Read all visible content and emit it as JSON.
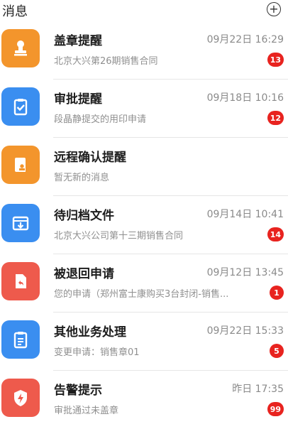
{
  "header": {
    "title": "消息",
    "add_icon": "plus-circle-icon"
  },
  "items": [
    {
      "icon": "stamp-icon",
      "color": "#f3952c",
      "title": "盖章提醒",
      "time": "09月22日 16:29",
      "subtitle": "北京大兴第26期销售合同",
      "badge": "13"
    },
    {
      "icon": "clipboard-check-icon",
      "color": "#3a8ef0",
      "title": "审批提醒",
      "time": "09月18日 10:16",
      "subtitle": "段晶静提交的用印申请",
      "badge": "12"
    },
    {
      "icon": "remote-confirm-icon",
      "color": "#f3952c",
      "title": "远程确认提醒",
      "time": "",
      "subtitle": "暂无新的消息",
      "badge": ""
    },
    {
      "icon": "archive-tray-icon",
      "color": "#3a8ef0",
      "title": "待归档文件",
      "time": "09月14日 10:41",
      "subtitle": "北京大兴公司第十三期销售合同",
      "badge": "14"
    },
    {
      "icon": "return-document-icon",
      "color": "#ee5a4c",
      "title": "被退回申请",
      "time": "09月12日 13:45",
      "subtitle": "您的申请（郑州富士康购买3台封闭-销售...",
      "badge": "1"
    },
    {
      "icon": "clipboard-list-icon",
      "color": "#3a8ef0",
      "title": "其他业务处理",
      "time": "09月22日 15:33",
      "subtitle": "变更申请：销售章01",
      "badge": "5"
    },
    {
      "icon": "alert-shield-icon",
      "color": "#ee5a4c",
      "title": "告警提示",
      "time": "昨日 17:35",
      "subtitle": "审批通过未盖章",
      "badge": "99"
    }
  ]
}
